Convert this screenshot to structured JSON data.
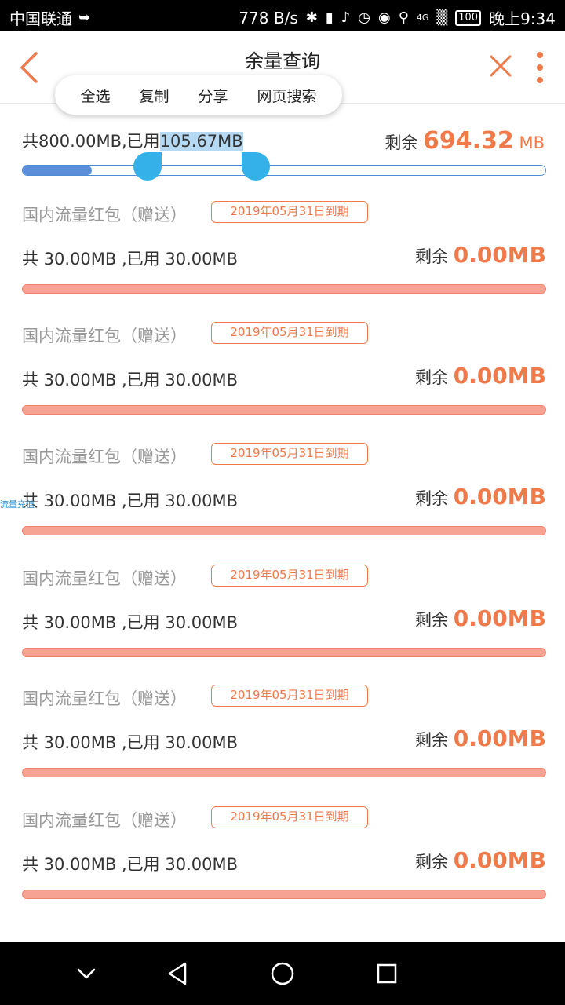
{
  "status": {
    "carrier": "中国联通",
    "speed": "778 B/s",
    "network": "4G",
    "battery": "100",
    "time": "晚上9:34"
  },
  "header": {
    "title": "余量查询"
  },
  "context_menu": {
    "items": [
      "全选",
      "复制",
      "分享",
      "网页搜索"
    ]
  },
  "main": {
    "total_prefix": "共800.00MB,已用",
    "used": "105.67MB",
    "remain_label": "剩余",
    "remain_value": "694.32",
    "remain_unit": "MB",
    "used_fraction": 0.1321
  },
  "packages": [
    {
      "name": "国内流量红包（赠送）",
      "expiry": "2019年05月31日到期",
      "usage": "共 30.00MB ,已用 30.00MB",
      "remain_label": "剩余",
      "remain_value": "0.00MB"
    },
    {
      "name": "国内流量红包（赠送）",
      "expiry": "2019年05月31日到期",
      "usage": "共 30.00MB ,已用 30.00MB",
      "remain_label": "剩余",
      "remain_value": "0.00MB"
    },
    {
      "name": "国内流量红包（赠送）",
      "expiry": "2019年05月31日到期",
      "usage": "共 30.00MB ,已用 30.00MB",
      "remain_label": "剩余",
      "remain_value": "0.00MB"
    },
    {
      "name": "国内流量红包（赠送）",
      "expiry": "2019年05月31日到期",
      "usage": "共 30.00MB ,已用 30.00MB",
      "remain_label": "剩余",
      "remain_value": "0.00MB"
    },
    {
      "name": "国内流量红包（赠送）",
      "expiry": "2019年05月31日到期",
      "usage": "共 30.00MB ,已用 30.00MB",
      "remain_label": "剩余",
      "remain_value": "0.00MB"
    },
    {
      "name": "国内流量红包（赠送）",
      "expiry": "2019年05月31日到期",
      "usage": "共 30.00MB ,已用 30.00MB",
      "remain_label": "剩余",
      "remain_value": "0.00MB"
    }
  ],
  "float_tag": "流量充值",
  "colors": {
    "accent": "#f07a4a",
    "bar_blue": "#5b8fd9",
    "handle": "#34b1e8",
    "pkg_bar": "#f6a394"
  },
  "icons": [
    "back-arrow-icon",
    "close-icon",
    "more-vert-icon",
    "nav-back-icon",
    "nav-home-icon",
    "nav-recents-icon",
    "nav-down-icon"
  ]
}
